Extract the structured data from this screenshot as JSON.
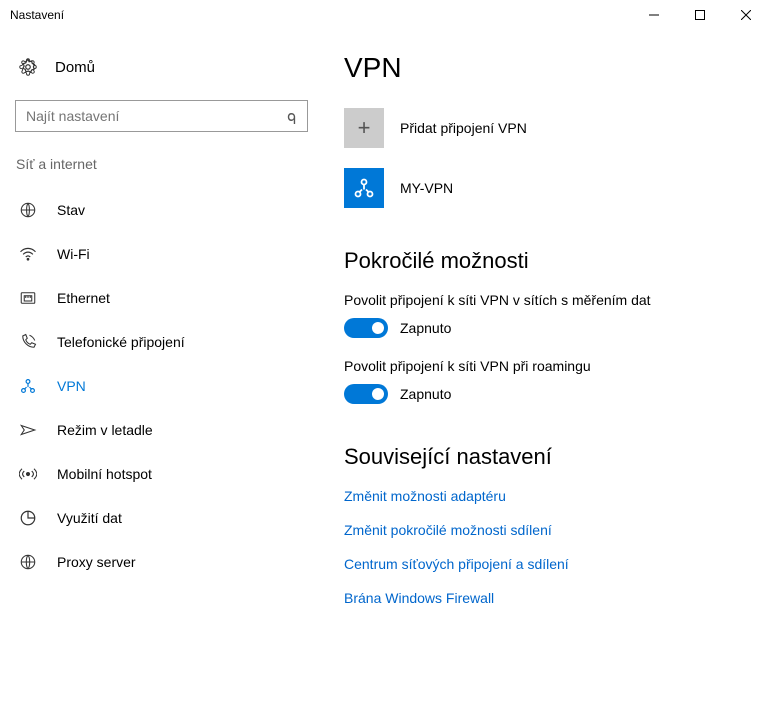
{
  "window": {
    "title": "Nastavení"
  },
  "sidebar": {
    "home": "Domů",
    "search_placeholder": "Najít nastavení",
    "category": "Síť a internet",
    "items": [
      {
        "label": "Stav"
      },
      {
        "label": "Wi-Fi"
      },
      {
        "label": "Ethernet"
      },
      {
        "label": "Telefonické připojení"
      },
      {
        "label": "VPN"
      },
      {
        "label": "Režim v letadle"
      },
      {
        "label": "Mobilní hotspot"
      },
      {
        "label": "Využití dat"
      },
      {
        "label": "Proxy server"
      }
    ]
  },
  "main": {
    "title": "VPN",
    "add_label": "Přidat připojení VPN",
    "vpn_name": "MY-VPN",
    "adv_heading": "Pokročilé možnosti",
    "adv1_label": "Povolit připojení k síti VPN v sítích s měřením dat",
    "adv1_state": "Zapnuto",
    "adv2_label": "Povolit připojení k síti VPN při roamingu",
    "adv2_state": "Zapnuto",
    "related_heading": "Související nastavení",
    "link1": "Změnit možnosti adaptéru",
    "link2": "Změnit pokročilé možnosti sdílení",
    "link3": "Centrum síťových připojení a sdílení",
    "link4": "Brána Windows Firewall"
  }
}
